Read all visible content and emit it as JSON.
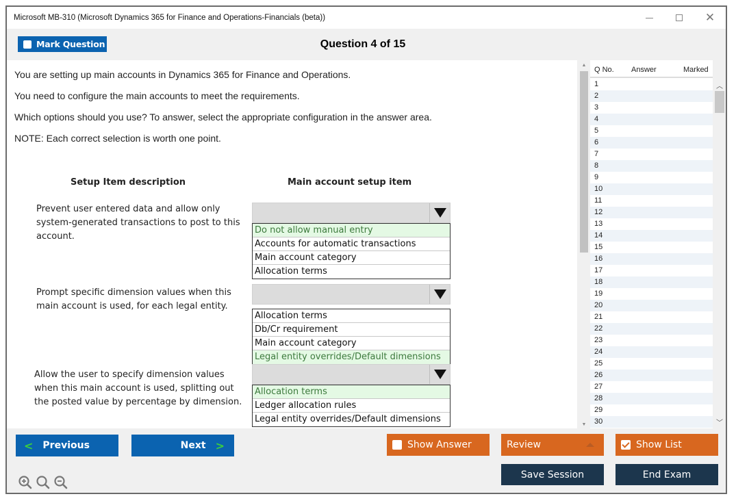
{
  "window": {
    "title": "Microsoft MB-310 (Microsoft Dynamics 365 for Finance and Operations-Financials (beta))",
    "controls": [
      "minimize",
      "maximize",
      "close"
    ]
  },
  "toolbar": {
    "mark_question_label": "Mark Question",
    "mark_question_checked": false,
    "question_title": "Question 4 of 15"
  },
  "question": {
    "paragraphs": [
      "You are setting up main accounts in Dynamics 365 for Finance and Operations.",
      "You need to configure the main accounts to meet the requirements.",
      "Which options should you use? To answer, select the appropriate configuration in the answer area.",
      "NOTE: Each correct selection is worth one point."
    ],
    "column_headers": {
      "left": "Setup Item description",
      "right": "Main account setup item"
    },
    "items": [
      {
        "description": "Prevent user entered data and allow only system-generated transactions to post to this account.",
        "description_lines": [
          "Prevent user entered data and allow only",
          "system-generated transactions to post to this",
          "account."
        ],
        "options": [
          "Do not allow manual entry",
          "Accounts for automatic transactions",
          "Main account category",
          "Allocation terms"
        ],
        "highlighted_option": "Do not allow manual entry"
      },
      {
        "description": "Prompt specific dimension values when this main account is used, for each legal entity.",
        "description_lines": [
          "Prompt specific dimension values when this",
          "main account is used, for each legal entity."
        ],
        "options": [
          "Allocation terms",
          "Db/Cr requirement",
          "Main account category",
          "Legal entity overrides/Default dimensions"
        ],
        "highlighted_option": "Legal entity overrides/Default dimensions"
      },
      {
        "description": "Allow the user to specify dimension values when this main account is used, splitting out the posted value by percentage by dimension.",
        "description_lines": [
          "Allow the user to specify dimension values",
          "when this main account is used, splitting out",
          "the posted value by percentage by dimension."
        ],
        "options": [
          "Allocation terms",
          "Ledger allocation rules",
          "Legal entity overrides/Default dimensions"
        ],
        "highlighted_option": "Allocation terms"
      }
    ]
  },
  "question_list": {
    "headers": [
      "Q No.",
      "Answer",
      "Marked"
    ],
    "rows": [
      "1",
      "2",
      "3",
      "4",
      "5",
      "6",
      "7",
      "8",
      "9",
      "10",
      "11",
      "12",
      "13",
      "14",
      "15",
      "16",
      "17",
      "18",
      "19",
      "20",
      "21",
      "22",
      "23",
      "24",
      "25",
      "26",
      "27",
      "28",
      "29",
      "30"
    ]
  },
  "bottom": {
    "previous_label": "Previous",
    "next_label": "Next",
    "show_answer_label": "Show Answer",
    "show_answer_checked": false,
    "review_label": "Review",
    "show_list_label": "Show List",
    "show_list_checked": true,
    "save_session_label": "Save Session",
    "end_exam_label": "End Exam",
    "zoom_icons": [
      "zoom-in-icon",
      "zoom-reset-icon",
      "zoom-out-icon"
    ]
  },
  "colors": {
    "primary_blue": "#0b63b0",
    "orange": "#d8671f",
    "navy": "#1c364d",
    "correct_highlight": "#e4f9e4",
    "chevron_green": "#3ccf3c"
  }
}
